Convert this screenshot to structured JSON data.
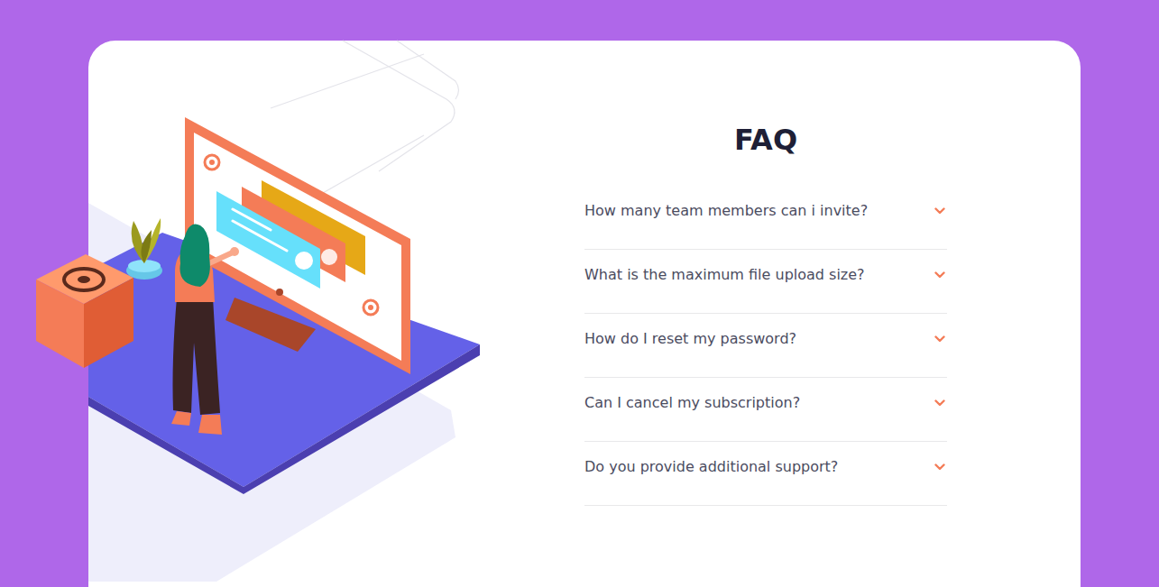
{
  "faq": {
    "title": "FAQ",
    "items": [
      {
        "question": "How many team members can i invite?",
        "expanded": false
      },
      {
        "question": "What is the maximum file upload size?",
        "expanded": false
      },
      {
        "question": "How do I reset my password?",
        "expanded": false
      },
      {
        "question": "Can I cancel my subscription?",
        "expanded": false
      },
      {
        "question": "Do you provide additional support?",
        "expanded": false
      }
    ]
  }
}
